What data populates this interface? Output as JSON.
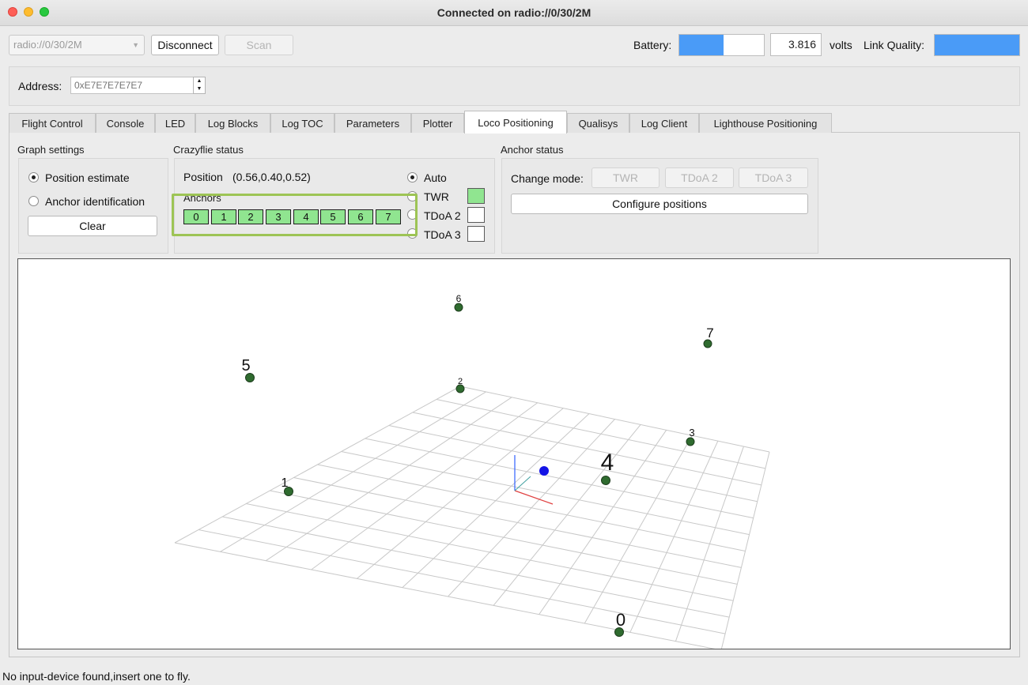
{
  "window": {
    "title": "Connected on radio://0/30/2M"
  },
  "toolbar": {
    "uri_value": "radio://0/30/2M",
    "disconnect_label": "Disconnect",
    "scan_label": "Scan",
    "battery_label": "Battery:",
    "battery_level": 0.52,
    "voltage_value": "3.816",
    "volts_label": "volts",
    "link_quality_label": "Link Quality:",
    "link_quality_level": 1.0
  },
  "address": {
    "label": "Address:",
    "placeholder": "0xE7E7E7E7E7"
  },
  "tabs": [
    {
      "label": "Flight Control"
    },
    {
      "label": "Console"
    },
    {
      "label": "LED"
    },
    {
      "label": "Log Blocks"
    },
    {
      "label": "Log TOC"
    },
    {
      "label": "Parameters"
    },
    {
      "label": "Plotter"
    },
    {
      "label": "Loco Positioning"
    },
    {
      "label": "Qualisys"
    },
    {
      "label": "Log Client"
    },
    {
      "label": "Lighthouse Positioning"
    }
  ],
  "graph_settings": {
    "title": "Graph settings",
    "position_estimate": "Position estimate",
    "anchor_identification": "Anchor identification",
    "clear_label": "Clear"
  },
  "crazyflie_status": {
    "title": "Crazyflie status",
    "position_label": "Position",
    "position_value": "(0.56,0.40,0.52)",
    "anchors_label": "Anchors",
    "anchors": [
      "0",
      "1",
      "2",
      "3",
      "4",
      "5",
      "6",
      "7"
    ],
    "modes": [
      {
        "label": "Auto",
        "selected": true
      },
      {
        "label": "TWR",
        "active": true
      },
      {
        "label": "TDoA 2",
        "active": false
      },
      {
        "label": "TDoA 3",
        "active": false
      }
    ]
  },
  "anchor_status": {
    "title": "Anchor status",
    "change_mode_label": "Change mode:",
    "twr_label": "TWR",
    "tdoa2_label": "TDoA 2",
    "tdoa3_label": "TDoA 3",
    "configure_label": "Configure positions"
  },
  "plot_anchors": [
    "0",
    "1",
    "2",
    "3",
    "4",
    "5",
    "6",
    "7"
  ],
  "colors": {
    "accent": "#4a9bf7",
    "anchor_green": "#90e590",
    "highlight": "#9dc455",
    "anchor_dot": "#2f6b2f",
    "drone_dot": "#1414e6"
  },
  "status_bar": {
    "message": "No input-device found,insert one to fly."
  }
}
